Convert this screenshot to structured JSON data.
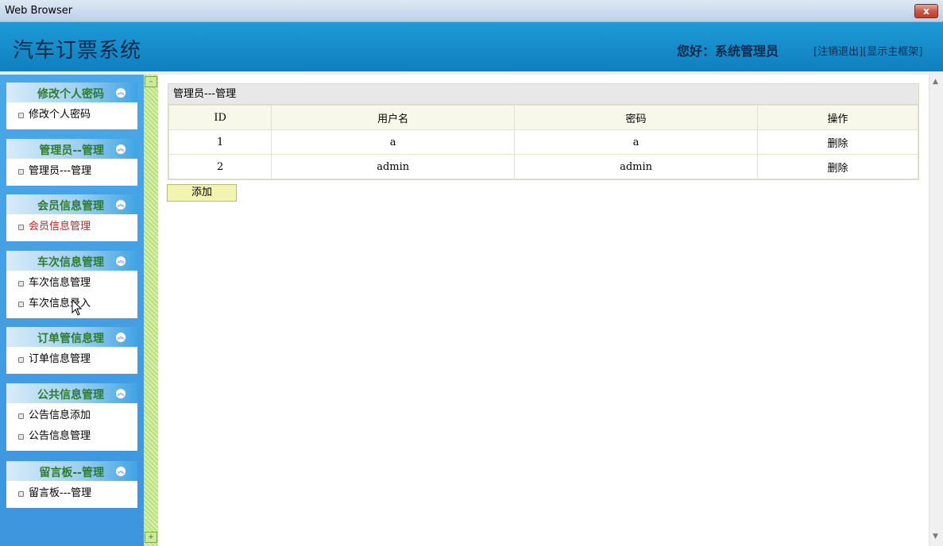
{
  "window": {
    "title": "Web Browser",
    "close_label": "x"
  },
  "header": {
    "app_title": "汽车订票系统",
    "greeting": "您好：系统管理员",
    "logout_link": "[注销退出]",
    "show_frame_link": "[显示主框架]"
  },
  "sidebar": {
    "groups": [
      {
        "title": "修改个人密码",
        "items": [
          {
            "label": "修改个人密码"
          }
        ]
      },
      {
        "title": "管理员--管理",
        "items": [
          {
            "label": "管理员---管理"
          }
        ]
      },
      {
        "title": "会员信息管理",
        "items": [
          {
            "label": "会员信息管理"
          }
        ]
      },
      {
        "title": "车次信息管理",
        "items": [
          {
            "label": "车次信息管理"
          },
          {
            "label": "车次信息录入"
          }
        ]
      },
      {
        "title": "订单管信息理",
        "items": [
          {
            "label": "订单信息管理"
          }
        ]
      },
      {
        "title": "公共信息管理",
        "items": [
          {
            "label": "公告信息添加"
          },
          {
            "label": "公告信息管理"
          }
        ]
      },
      {
        "title": "留言板--管理",
        "items": [
          {
            "label": "留言板---管理"
          }
        ]
      }
    ],
    "active_item": "会员信息管理"
  },
  "main": {
    "panel_title": "管理员---管理",
    "columns": [
      "ID",
      "用户名",
      "密码",
      "操作"
    ],
    "rows": [
      {
        "id": "1",
        "username": "a",
        "password": "a",
        "action": "删除"
      },
      {
        "id": "2",
        "username": "admin",
        "password": "admin",
        "action": "删除"
      }
    ],
    "add_button": "添加"
  },
  "icons": {
    "collapse": "chevron-up-icon",
    "bullet": "bullet-icon"
  },
  "colors": {
    "header_bg": "#1a8fd0",
    "sidebar_bg": "#4aa8e8",
    "group_title": "#2f7b2f",
    "active_item": "#c81e1e",
    "add_button_bg": "#f2f5b0"
  }
}
